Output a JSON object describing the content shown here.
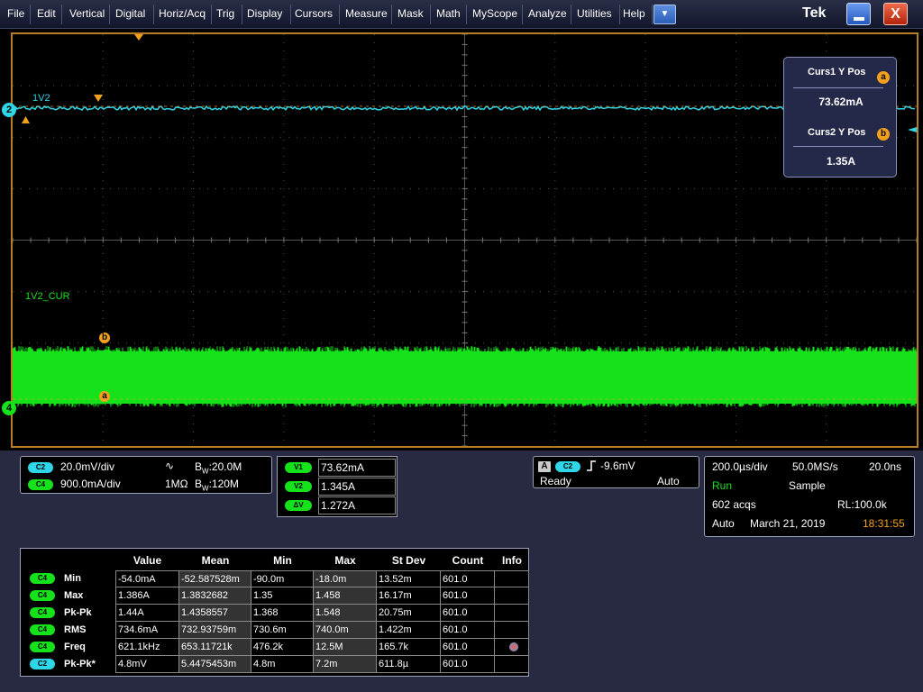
{
  "menu": [
    "File",
    "Edit",
    "Vertical",
    "Digital",
    "Horiz/Acq",
    "Trig",
    "Display",
    "Cursors",
    "Measure",
    "Mask",
    "Math",
    "MyScope",
    "Analyze",
    "Utilities",
    "Help"
  ],
  "menu_dropdown_glyph": "▼",
  "brand": "Tek",
  "window_buttons": {
    "close_glyph": "X"
  },
  "waveform": {
    "ch2_label": "1V2",
    "ch4_label": "1V2_CUR",
    "ch2_marker": "2",
    "ch4_marker": "4",
    "cursor_a": "a",
    "cursor_b": "b",
    "colors": {
      "ch2": "#2fd6e8",
      "ch4": "#16e21b",
      "cursor": "#f3a11d",
      "frame": "#b77d25",
      "grid": "#6b6b6b"
    }
  },
  "cursor_readout": {
    "curs1_label": "Curs1 Y Pos",
    "curs1_value": "73.62mA",
    "curs1_badge": "a",
    "curs2_label": "Curs2 Y Pos",
    "curs2_value": "1.35A",
    "curs2_badge": "b"
  },
  "channels": [
    {
      "badge": "C2",
      "scale": "20.0mV/div",
      "coupling_icon": "∿",
      "impedance": "",
      "bw_prefix": "B",
      "bw_sub": "W",
      "bw": ":20.0M"
    },
    {
      "badge": "C4",
      "scale": "900.0mA/div",
      "coupling_icon": "",
      "impedance": "1MΩ",
      "bw_prefix": "B",
      "bw_sub": "W",
      "bw": ":120M"
    }
  ],
  "cursor_values": [
    {
      "badge": "V1",
      "value": "73.62mA"
    },
    {
      "badge": "V2",
      "value": "1.345A"
    },
    {
      "badge": "ΔV",
      "value": "1.272A"
    }
  ],
  "trigger": {
    "mode_badge": "A",
    "source": "C2",
    "level": "-9.6mV",
    "state": "Ready",
    "mode": "Auto"
  },
  "acquisition": {
    "timebase": "200.0µs/div",
    "sample_rate": "50.0MS/s",
    "resolution": "20.0ns",
    "state": "Run",
    "mode": "Sample",
    "acqs": "602 acqs",
    "record_length": "RL:100.0k",
    "trig_mode": "Auto",
    "date": "March 21, 2019",
    "time": "18:31:55"
  },
  "measurements": {
    "headers": [
      "Value",
      "Mean",
      "Min",
      "Max",
      "St Dev",
      "Count",
      "Info"
    ],
    "rows": [
      {
        "badge": "C4",
        "name": "Min",
        "cells": [
          "-54.0mA",
          "-52.587528m",
          "-90.0m",
          "-18.0m",
          "13.52m",
          "601.0",
          ""
        ]
      },
      {
        "badge": "C4",
        "name": "Max",
        "cells": [
          "1.386A",
          "1.3832682",
          "1.35",
          "1.458",
          "16.17m",
          "601.0",
          ""
        ]
      },
      {
        "badge": "C4",
        "name": "Pk-Pk",
        "cells": [
          "1.44A",
          "1.4358557",
          "1.368",
          "1.548",
          "20.75m",
          "601.0",
          ""
        ]
      },
      {
        "badge": "C4",
        "name": "RMS",
        "cells": [
          "734.6mA",
          "732.93759m",
          "730.6m",
          "740.0m",
          "1.422m",
          "601.0",
          ""
        ]
      },
      {
        "badge": "C4",
        "name": "Freq",
        "cells": [
          "621.1kHz",
          "653.11721k",
          "476.2k",
          "12.5M",
          "165.7k",
          "601.0",
          ""
        ]
      },
      {
        "badge": "C2",
        "name": "Pk-Pk*",
        "cells": [
          "4.8mV",
          "5.4475453m",
          "4.8m",
          "7.2m",
          "611.8µ",
          "601.0",
          ""
        ]
      }
    ]
  }
}
